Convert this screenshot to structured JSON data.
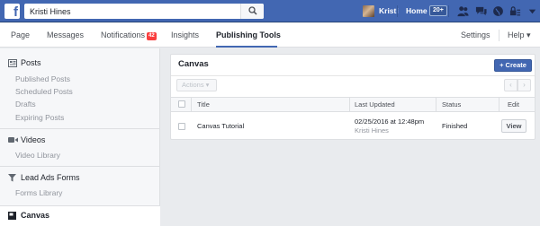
{
  "topbar": {
    "logo": "f",
    "search_value": "Kristi Hines",
    "search_icon": "search-icon",
    "user_name": "Kristi",
    "home_label": "Home",
    "home_badge": "20+",
    "icons": [
      "friend-requests-icon",
      "messages-icon",
      "notifications-globe-icon",
      "privacy-lock-icon",
      "account-menu-icon"
    ]
  },
  "pagenav": {
    "tabs": [
      {
        "label": "Page"
      },
      {
        "label": "Messages"
      },
      {
        "label": "Notifications",
        "badge": "42"
      },
      {
        "label": "Insights"
      },
      {
        "label": "Publishing Tools",
        "active": true
      }
    ],
    "settings": "Settings",
    "help": "Help ▾"
  },
  "sidebar": {
    "posts": {
      "title": "Posts",
      "items": [
        "Published Posts",
        "Scheduled Posts",
        "Drafts",
        "Expiring Posts"
      ]
    },
    "videos": {
      "title": "Videos",
      "items": [
        "Video Library"
      ]
    },
    "lead_ads": {
      "title": "Lead Ads Forms",
      "items": [
        "Forms Library"
      ]
    },
    "canvas": {
      "title": "Canvas"
    }
  },
  "main": {
    "title": "Canvas",
    "create_label": "+ Create",
    "actions_label": "Actions ▾",
    "pager_prev": "‹",
    "pager_next": "›",
    "columns": [
      "Title",
      "Last Updated",
      "Status",
      "Edit"
    ],
    "rows": [
      {
        "title": "Canvas Tutorial",
        "last_updated": "02/25/2016 at 12:48pm",
        "updated_by": "Kristi Hines",
        "status": "Finished",
        "edit": "View"
      }
    ]
  },
  "colors": {
    "brand_blue": "#4267b2",
    "badge_red": "#fa3e3e",
    "page_bg": "#e9ebee"
  }
}
